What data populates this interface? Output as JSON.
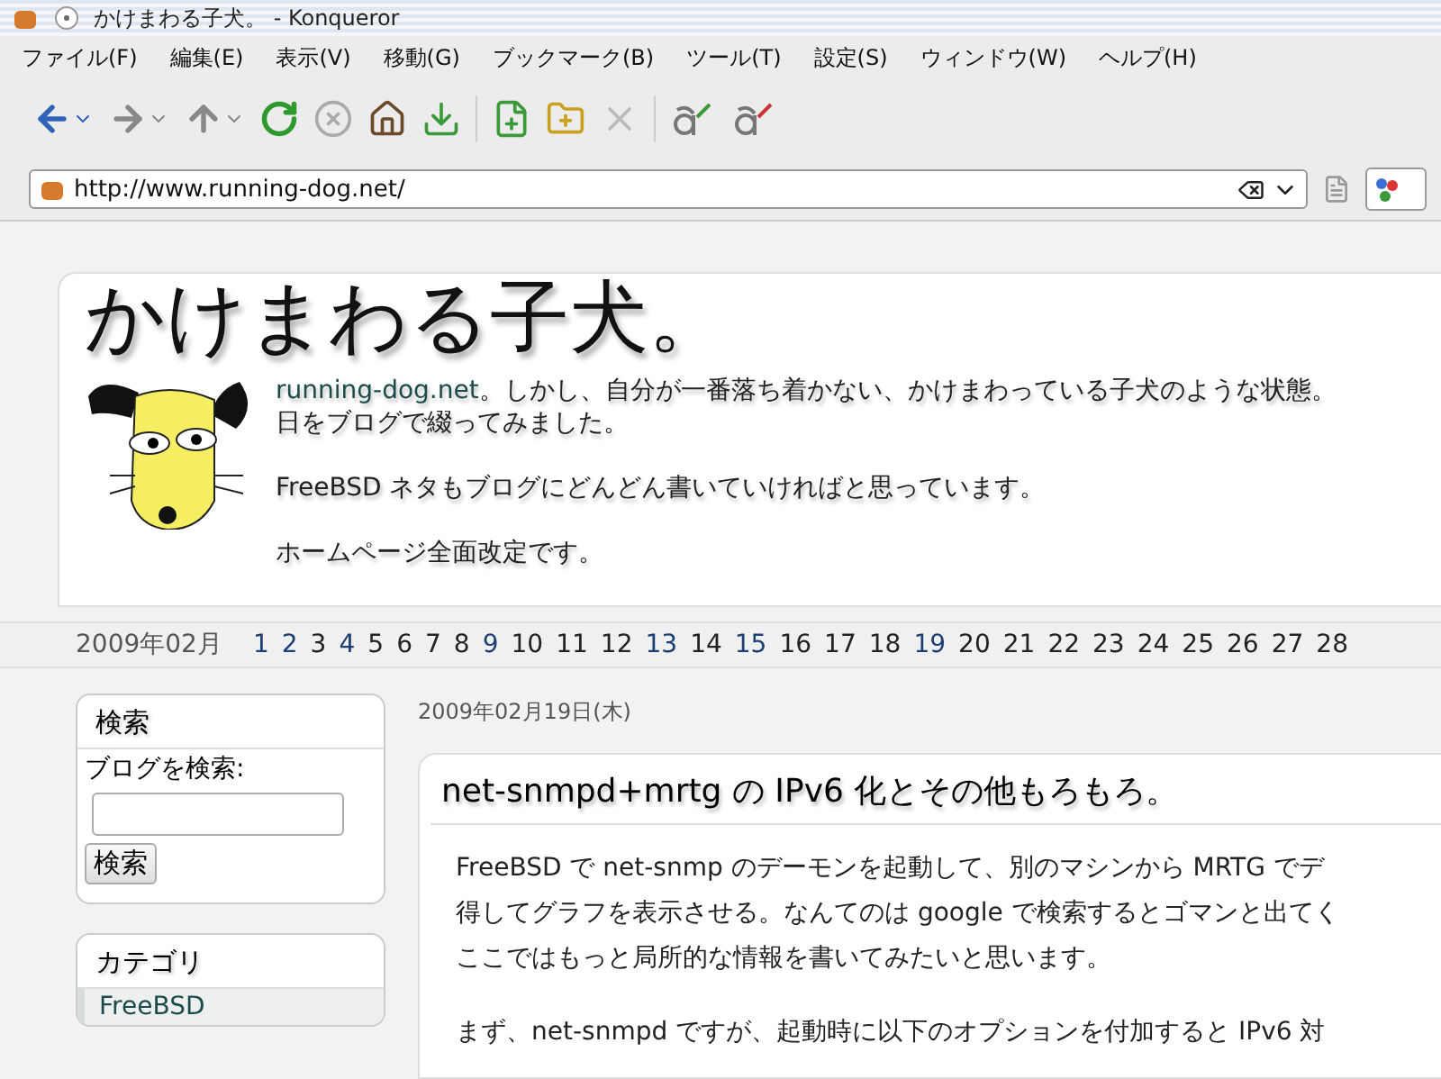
{
  "window": {
    "title": "かけまわる子犬。 - Konqueror"
  },
  "menu": [
    "ファイル(F)",
    "編集(E)",
    "表示(V)",
    "移動(G)",
    "ブックマーク(B)",
    "ツール(T)",
    "設定(S)",
    "ウィンドウ(W)",
    "ヘルプ(H)"
  ],
  "location": {
    "url": "http://www.running-dog.net/"
  },
  "blog": {
    "title": "かけまわる子犬。",
    "intro_link": "running-dog.net",
    "intro_lines": [
      "。しかし、自分が一番落ち着かない、かけまわっている子犬のような状態。",
      "日をブログで綴ってみました。"
    ],
    "paragraphs": [
      "FreeBSD ネタもブログにどんどん書いていければと思っています。",
      "ホームページ全面改定です。"
    ]
  },
  "calendar": {
    "month": "2009年02月",
    "days": [
      {
        "label": "1",
        "linked": true
      },
      {
        "label": "2",
        "linked": true
      },
      {
        "label": "3",
        "linked": false
      },
      {
        "label": "4",
        "linked": true
      },
      {
        "label": "5",
        "linked": false
      },
      {
        "label": "6",
        "linked": false
      },
      {
        "label": "7",
        "linked": false
      },
      {
        "label": "8",
        "linked": false
      },
      {
        "label": "9",
        "linked": true
      },
      {
        "label": "10",
        "linked": false
      },
      {
        "label": "11",
        "linked": false
      },
      {
        "label": "12",
        "linked": false
      },
      {
        "label": "13",
        "linked": true
      },
      {
        "label": "14",
        "linked": false
      },
      {
        "label": "15",
        "linked": true
      },
      {
        "label": "16",
        "linked": false
      },
      {
        "label": "17",
        "linked": false
      },
      {
        "label": "18",
        "linked": false
      },
      {
        "label": "19",
        "linked": true
      },
      {
        "label": "20",
        "linked": false
      },
      {
        "label": "21",
        "linked": false
      },
      {
        "label": "22",
        "linked": false
      },
      {
        "label": "23",
        "linked": false
      },
      {
        "label": "24",
        "linked": false
      },
      {
        "label": "25",
        "linked": false
      },
      {
        "label": "26",
        "linked": false
      },
      {
        "label": "27",
        "linked": false
      },
      {
        "label": "28",
        "linked": false
      }
    ]
  },
  "sidebar": {
    "search": {
      "heading": "検索",
      "label": "ブログを検索:",
      "button": "検索"
    },
    "categories": {
      "heading": "カテゴリ",
      "items": [
        "FreeBSD"
      ]
    }
  },
  "post": {
    "date": "2009年02月19日(木)",
    "title": "net-snmpd+mrtg の IPv6 化とその他もろもろ。",
    "paragraphs": [
      [
        "FreeBSD で net-snmp のデーモンを起動して、別のマシンから MRTG でデ",
        "得してグラフを表示させる。なんてのは google で検索するとゴマンと出てく",
        "ここではもっと局所的な情報を書いてみたいと思います。"
      ],
      [
        "まず、net-snmpd ですが、起動時に以下のオプションを付加すると IPv6 対"
      ]
    ]
  }
}
